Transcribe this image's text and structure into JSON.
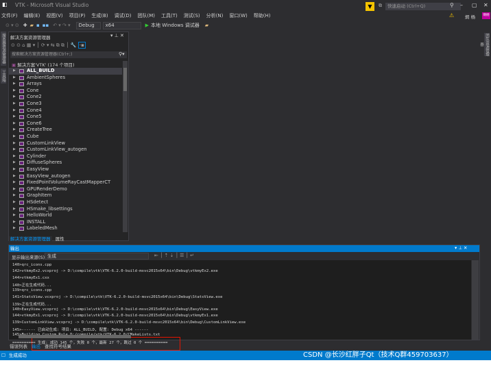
{
  "window": {
    "title": "VTK - Microsoft Visual Studio",
    "quick_launch_placeholder": "快速启动 (Ctrl+Q)",
    "user": "炯 杨",
    "user_badge": "炯杨"
  },
  "menu": [
    "文件(F)",
    "编辑(E)",
    "视图(V)",
    "项目(P)",
    "生成(B)",
    "调试(D)",
    "团队(M)",
    "工具(T)",
    "测试(S)",
    "分析(N)",
    "窗口(W)",
    "帮助(H)"
  ],
  "toolbar": {
    "config": "Debug",
    "platform": "x64",
    "run_label": "本地 Windows 调试器"
  },
  "left_tabs": [
    "服务器资源管理器",
    "工具箱"
  ],
  "right_tabs": [
    "团队资源管理器"
  ],
  "solution_explorer": {
    "title": "解决方案资源管理器",
    "search_placeholder": "搜索解决方案资源管理器(Ctrl+;)",
    "solution": "解决方案'VTK' (174 个项目)",
    "items": [
      "ALL_BUILD",
      "AmbientSpheres",
      "Arrays",
      "Cone",
      "Cone2",
      "Cone3",
      "Cone4",
      "Cone5",
      "Cone6",
      "CreateTree",
      "Cube",
      "CustomLinkView",
      "CustomLinkView_autogen",
      "Cylinder",
      "DiffuseSpheres",
      "EasyView",
      "EasyView_autogen",
      "FixedPointVolumeRayCastMapperCT",
      "GPURenderDemo",
      "GraphItem",
      "HSdetect",
      "HSmake_libsettings",
      "HelloWorld",
      "INSTALL",
      "LabeledMesh"
    ],
    "tabs": [
      "解决方案资源管理器",
      "属性"
    ]
  },
  "output": {
    "title": "输出",
    "source_label": "显示输出来源(S):",
    "source_value": "生成",
    "lines": [
      "140>qrc_icons.cpp",
      "142>vtkmyEx2.vcxproj -> D:\\compile\\vtk\\VTK-6.2.0-build-msvc2015x64\\bin\\Debug\\vtkmyEx2.exe",
      "144>vtkmyEx1.cxx",
      "140>正在生成代码...",
      "139>qrc_icons.cpp",
      "141>StatsView.vcxproj -> D:\\compile\\vtk\\VTK-6.2.0-build-msvc2015x64\\bin\\Debug\\StatsView.exe",
      "139>正在生成代码...",
      "140>EasyView.vcxproj -> D:\\compile\\vtk\\VTK-6.2.0-build-msvc2015x64\\bin\\Debug\\EasyView.exe",
      "144>vtkmyEx1.vcxproj -> D:\\compile\\vtk\\VTK-6.2.0-build-msvc2015x64\\bin\\Debug\\vtkmyEx1.exe",
      "139>CustomLinkView.vcxproj -> D:\\compile\\vtk\\VTK-6.2.0-build-msvc2015x64\\bin\\Debug\\CustomLinkView.exe",
      "145>------ 已启动生成: 项目: ALL_BUILD, 配置: Debug x64 ------",
      "145>Building Custom Rule D:/compile/vtk/VTK-6.2.0/CMakeLists.txt",
      "========== 生成: 成功 145 个，失败 0 个，最新 27 个，跳过 0 个 =========="
    ]
  },
  "bottom_tabs": [
    "错误列表",
    "输出",
    "查找符号结果"
  ],
  "status": {
    "text": "生成成功",
    "watermark": "CSDN @长沙红胖子Qt（技术Q群459703637）"
  },
  "colors": {
    "accent": "#007acc",
    "background": "#2d2d30",
    "highlight_box": "#e51400"
  }
}
